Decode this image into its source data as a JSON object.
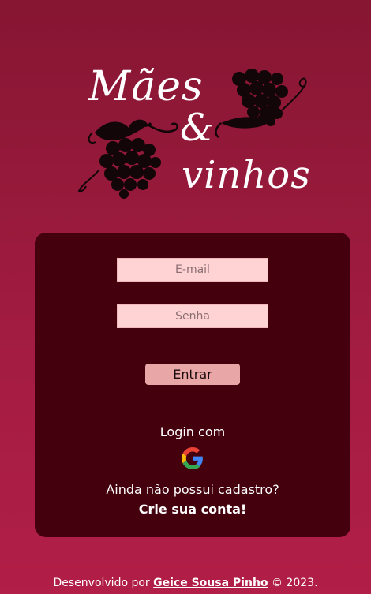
{
  "logo": {
    "line1": "Mães",
    "ampersand": "&",
    "line2": "vinhos",
    "left_icon": "grape-cluster-icon",
    "right_icon": "grape-cluster-icon"
  },
  "form": {
    "email_placeholder": "E-mail",
    "password_placeholder": "Senha",
    "submit_label": "Entrar",
    "login_with": "Login com",
    "google_icon": "google-icon",
    "no_account_text": "Ainda não possui cadastro?",
    "create_account_link": "Crie sua conta!"
  },
  "footer": {
    "prefix": "Desenvolvido por",
    "author": "Geice Sousa Pinho",
    "suffix": "© 2023."
  },
  "colors": {
    "background_top": "#861632",
    "background_bottom": "#b11e47",
    "card": "#44000d",
    "input_bg": "#ffd2d4",
    "button_bg": "#e8a6a6"
  }
}
